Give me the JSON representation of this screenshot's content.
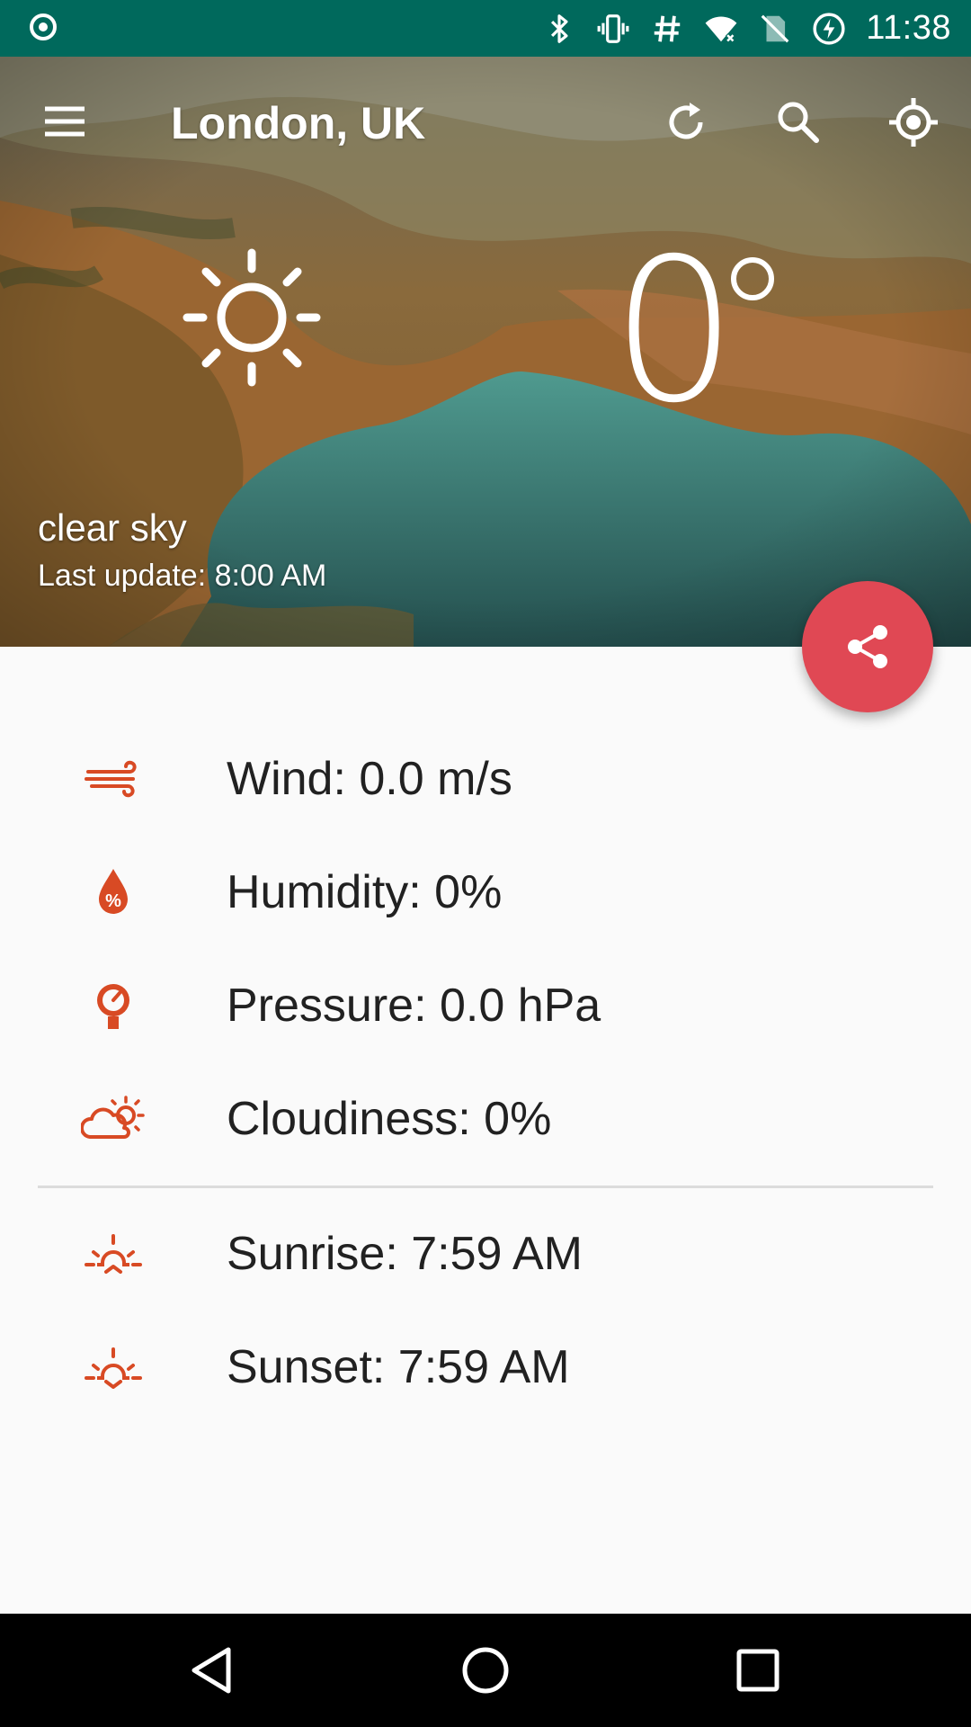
{
  "status_bar": {
    "time": "11:38",
    "icons": [
      "record-icon",
      "bluetooth-icon",
      "vibrate-icon",
      "hash-icon",
      "wifi-icon",
      "no-sim-icon",
      "battery-charging-icon"
    ]
  },
  "toolbar": {
    "menu_icon": "menu-icon",
    "city": "London, UK",
    "refresh_icon": "refresh-icon",
    "search_icon": "search-icon",
    "location_icon": "gps-icon"
  },
  "current": {
    "condition_icon": "sun-icon",
    "temperature": "0",
    "temperature_unit_icon": "degree-circle",
    "description": "clear sky",
    "last_update": "Last update: 8:00 AM"
  },
  "fab": {
    "icon": "share-icon"
  },
  "details": [
    {
      "icon": "wind-icon",
      "label": "Wind: 0.0 m/s"
    },
    {
      "icon": "humidity-icon",
      "label": "Humidity: 0%"
    },
    {
      "icon": "pressure-icon",
      "label": "Pressure: 0.0 hPa"
    },
    {
      "icon": "cloudiness-icon",
      "label": "Cloudiness: 0%"
    }
  ],
  "sun": [
    {
      "icon": "sunrise-icon",
      "label": "Sunrise: 7:59 AM"
    },
    {
      "icon": "sunset-icon",
      "label": "Sunset: 7:59 AM"
    }
  ],
  "colors": {
    "status_bar": "#00695c",
    "accent": "#d84a24",
    "fab": "#e04854",
    "text": "#212121",
    "background": "#fafafa"
  },
  "nav": {
    "back": "back-icon",
    "home": "home-icon",
    "recents": "recents-icon"
  }
}
